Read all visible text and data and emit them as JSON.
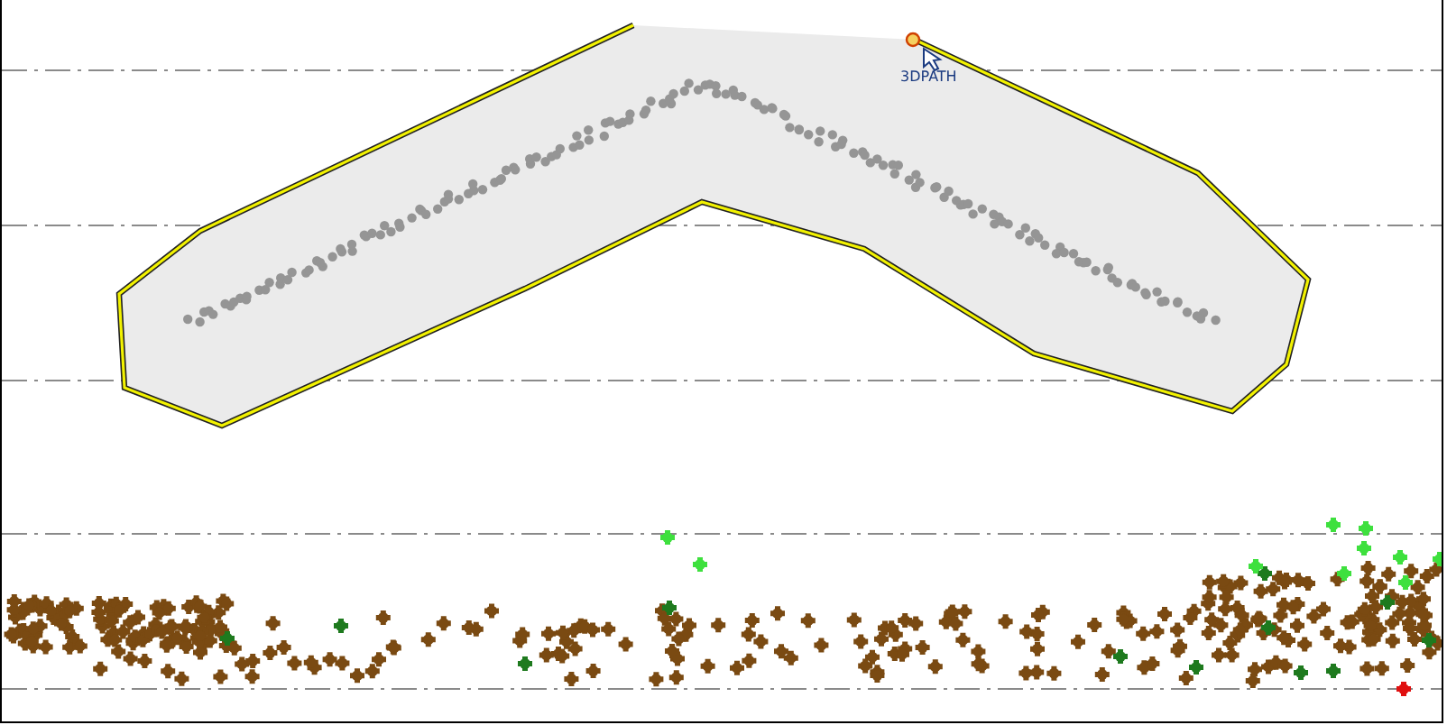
{
  "canvas": {
    "cursor_label": "3DPATH"
  }
}
